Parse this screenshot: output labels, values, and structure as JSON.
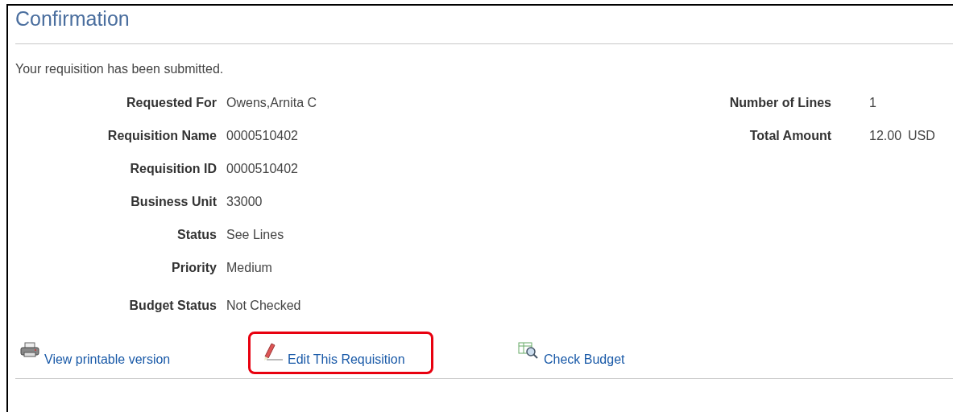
{
  "page": {
    "title": "Confirmation",
    "message": "Your requisition has been submitted."
  },
  "left_fields": [
    {
      "label": "Requested For",
      "value": "Owens,Arnita C"
    },
    {
      "label": "Requisition Name",
      "value": "0000510402"
    },
    {
      "label": "Requisition ID",
      "value": "0000510402"
    },
    {
      "label": "Business Unit",
      "value": "33000"
    },
    {
      "label": "Status",
      "value": "See Lines"
    },
    {
      "label": "Priority",
      "value": "Medium"
    },
    {
      "label": "Budget Status",
      "value": "Not Checked"
    }
  ],
  "right_fields": [
    {
      "label": "Number of Lines",
      "value": "1"
    },
    {
      "label": "Total Amount",
      "value": "12.00",
      "currency": "USD"
    }
  ],
  "actions": [
    {
      "kind": "print",
      "label": "View printable version",
      "highlighted": false
    },
    {
      "kind": "edit",
      "label": "Edit This Requisition",
      "highlighted": true
    },
    {
      "kind": "budget",
      "label": "Check Budget",
      "highlighted": false
    }
  ]
}
